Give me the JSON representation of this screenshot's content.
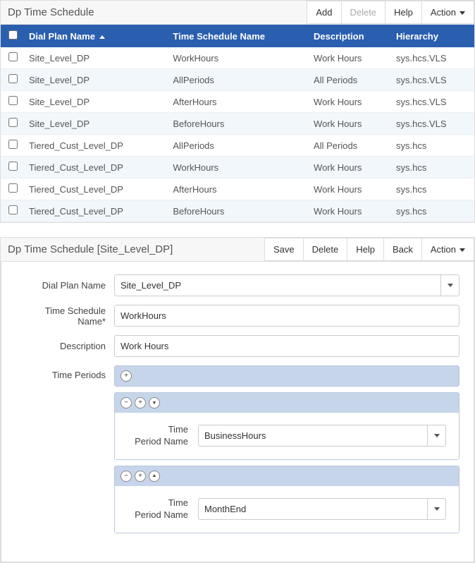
{
  "listPanel": {
    "title": "Dp Time Schedule",
    "buttons": {
      "add": "Add",
      "delete": "Delete",
      "help": "Help",
      "action": "Action"
    },
    "columns": {
      "dialPlan": "Dial Plan Name",
      "schedule": "Time Schedule Name",
      "description": "Description",
      "hierarchy": "Hierarchy"
    },
    "rows": [
      {
        "dialPlan": "Site_Level_DP",
        "schedule": "WorkHours",
        "description": "Work Hours",
        "hierarchy": "sys.hcs.VLS"
      },
      {
        "dialPlan": "Site_Level_DP",
        "schedule": "AllPeriods",
        "description": "All Periods",
        "hierarchy": "sys.hcs.VLS"
      },
      {
        "dialPlan": "Site_Level_DP",
        "schedule": "AfterHours",
        "description": "Work Hours",
        "hierarchy": "sys.hcs.VLS"
      },
      {
        "dialPlan": "Site_Level_DP",
        "schedule": "BeforeHours",
        "description": "Work Hours",
        "hierarchy": "sys.hcs.VLS"
      },
      {
        "dialPlan": "Tiered_Cust_Level_DP",
        "schedule": "AllPeriods",
        "description": "All Periods",
        "hierarchy": "sys.hcs"
      },
      {
        "dialPlan": "Tiered_Cust_Level_DP",
        "schedule": "WorkHours",
        "description": "Work Hours",
        "hierarchy": "sys.hcs"
      },
      {
        "dialPlan": "Tiered_Cust_Level_DP",
        "schedule": "AfterHours",
        "description": "Work Hours",
        "hierarchy": "sys.hcs"
      },
      {
        "dialPlan": "Tiered_Cust_Level_DP",
        "schedule": "BeforeHours",
        "description": "Work Hours",
        "hierarchy": "sys.hcs"
      }
    ]
  },
  "detailPanel": {
    "title": "Dp Time Schedule [Site_Level_DP]",
    "buttons": {
      "save": "Save",
      "delete": "Delete",
      "help": "Help",
      "back": "Back",
      "action": "Action"
    },
    "labels": {
      "dialPlan": "Dial Plan Name",
      "schedule": "Time Schedule Name*",
      "description": "Description",
      "timePeriods": "Time Periods",
      "periodName": "Time Period Name"
    },
    "values": {
      "dialPlan": "Site_Level_DP",
      "schedule": "WorkHours",
      "description": "Work Hours"
    },
    "periods": [
      {
        "name": "BusinessHours"
      },
      {
        "name": "MonthEnd"
      }
    ],
    "icons": {
      "plus": "+",
      "minus": "−",
      "up": "▲",
      "down": "▼"
    }
  }
}
